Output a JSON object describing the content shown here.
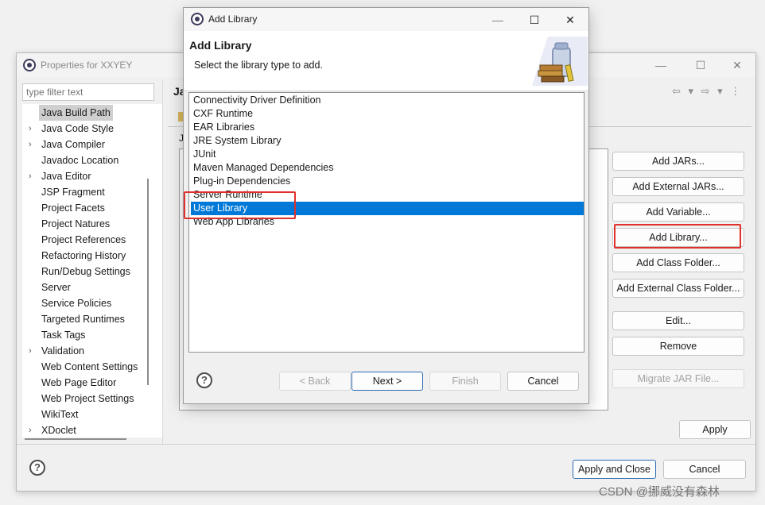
{
  "props_window": {
    "title": "Properties for XXYEY",
    "filter_placeholder": "type filter text",
    "tree_items": [
      {
        "label": "Java Build Path",
        "arrow": "",
        "selected": true
      },
      {
        "label": "Java Code Style",
        "arrow": "›"
      },
      {
        "label": "Java Compiler",
        "arrow": "›"
      },
      {
        "label": "Javadoc Location",
        "arrow": ""
      },
      {
        "label": "Java Editor",
        "arrow": "›"
      },
      {
        "label": "JSP Fragment",
        "arrow": ""
      },
      {
        "label": "Project Facets",
        "arrow": ""
      },
      {
        "label": "Project Natures",
        "arrow": ""
      },
      {
        "label": "Project References",
        "arrow": ""
      },
      {
        "label": "Refactoring History",
        "arrow": ""
      },
      {
        "label": "Run/Debug Settings",
        "arrow": ""
      },
      {
        "label": "Server",
        "arrow": ""
      },
      {
        "label": "Service Policies",
        "arrow": ""
      },
      {
        "label": "Targeted Runtimes",
        "arrow": ""
      },
      {
        "label": "Task Tags",
        "arrow": ""
      },
      {
        "label": "Validation",
        "arrow": "›"
      },
      {
        "label": "Web Content Settings",
        "arrow": ""
      },
      {
        "label": "Web Page Editor",
        "arrow": ""
      },
      {
        "label": "Web Project Settings",
        "arrow": ""
      },
      {
        "label": "WikiText",
        "arrow": ""
      },
      {
        "label": "XDoclet",
        "arrow": "›"
      }
    ],
    "right_title": "Ja",
    "j_hint": "J",
    "side_buttons": [
      {
        "label": "Add JARs...",
        "disabled": false
      },
      {
        "label": "Add External JARs...",
        "disabled": false
      },
      {
        "label": "Add Variable...",
        "disabled": false
      },
      {
        "label": "Add Library...",
        "disabled": false
      },
      {
        "label": "Add Class Folder...",
        "disabled": false
      },
      {
        "label": "Add External Class Folder...",
        "disabled": false
      },
      {
        "label": "Edit...",
        "disabled": false
      },
      {
        "label": "Remove",
        "disabled": false
      },
      {
        "label": "Migrate JAR File...",
        "disabled": true
      }
    ],
    "apply_label": "Apply",
    "apply_close_label": "Apply and Close",
    "cancel_label": "Cancel",
    "help_glyph": "?"
  },
  "dialog": {
    "title": "Add Library",
    "heading": "Add Library",
    "description": "Select the library type to add.",
    "library_types": [
      "Connectivity Driver Definition",
      "CXF Runtime",
      "EAR Libraries",
      "JRE System Library",
      "JUnit",
      "Maven Managed Dependencies",
      "Plug-in Dependencies",
      "Server Runtime",
      "User Library",
      "Web App Libraries"
    ],
    "selected_library": "User Library",
    "back_label": "< Back",
    "next_label": "Next >",
    "finish_label": "Finish",
    "cancel_label": "Cancel",
    "help_glyph": "?"
  },
  "window_controls": {
    "minimize": "—",
    "maximize": "☐",
    "close": "✕"
  },
  "watermark": "CSDN @挪威没有森林",
  "colors": {
    "selection": "#0078d7",
    "highlight_box": "#e0302b"
  }
}
